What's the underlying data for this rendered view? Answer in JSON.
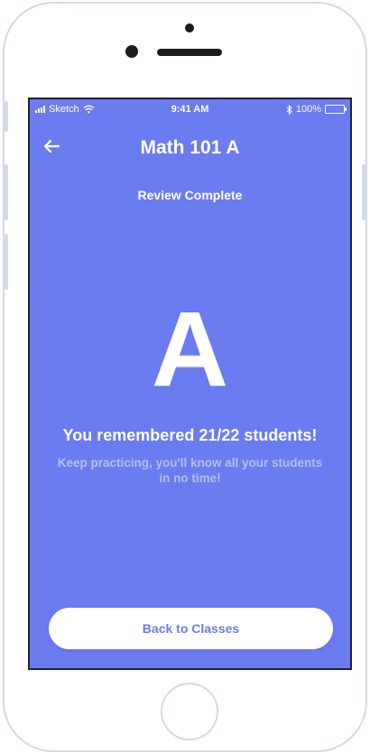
{
  "status_bar": {
    "carrier": "Sketch",
    "time": "9:41 AM",
    "battery": "100%"
  },
  "header": {
    "title": "Math 101 A",
    "back_icon": "arrow-left-icon"
  },
  "review": {
    "subtitle": "Review Complete",
    "grade": "A",
    "result": "You remembered 21/22 students!",
    "encouragement": "Keep practicing, you'll know all your students in no time!"
  },
  "actions": {
    "back_to_classes": "Back to Classes"
  },
  "colors": {
    "background": "#6a7cf0",
    "text": "#ffffff",
    "muted_text": "#b6bdf2",
    "button_bg": "#ffffff",
    "button_text": "#6a7cf0"
  }
}
